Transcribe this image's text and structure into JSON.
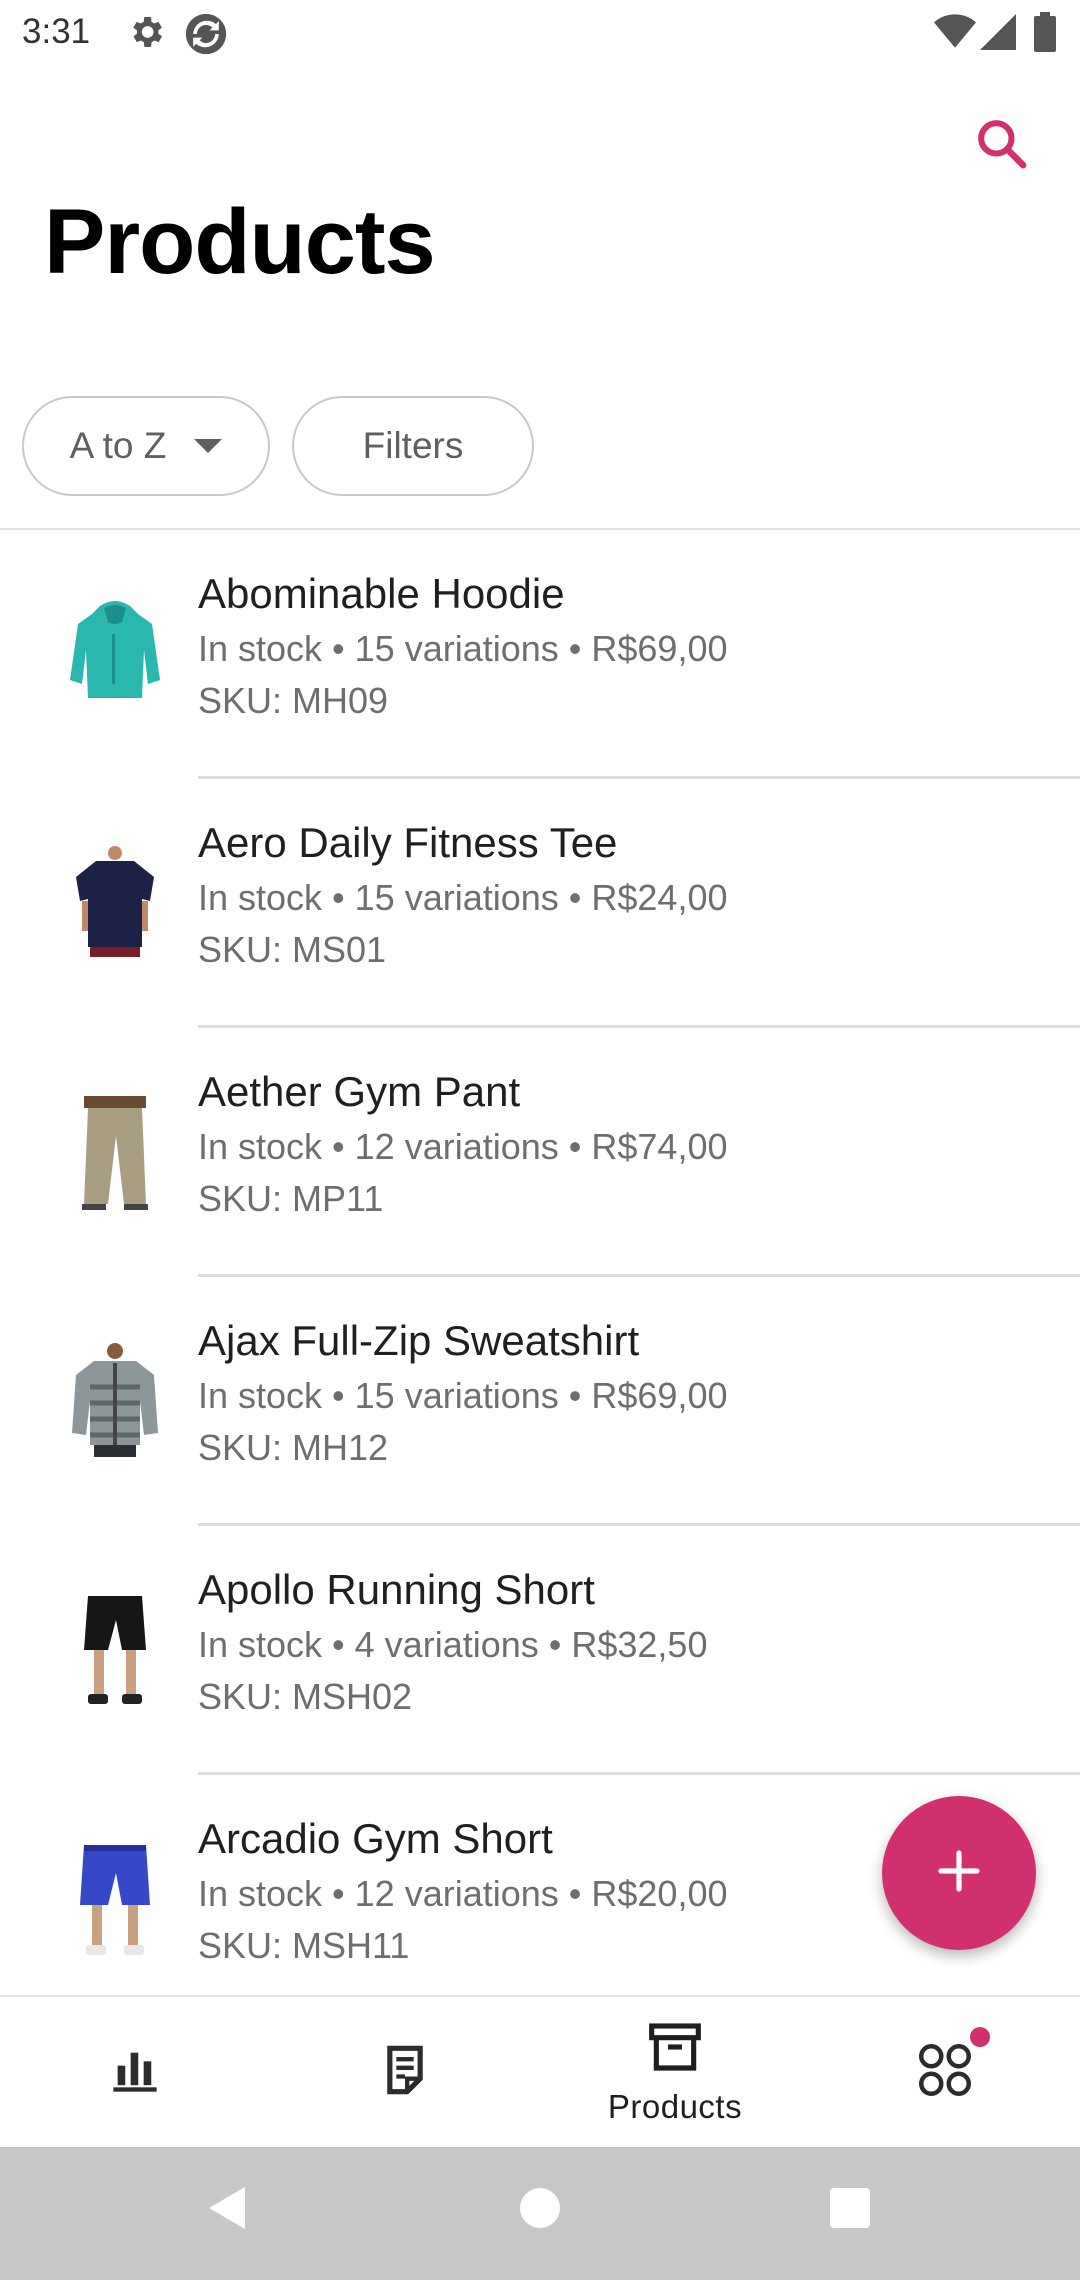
{
  "status_bar": {
    "time": "3:31",
    "icons": [
      "gear-icon",
      "sync-icon",
      "wifi-icon",
      "signal-icon",
      "battery-icon"
    ]
  },
  "header": {
    "title": "Products",
    "search_icon": "search-icon"
  },
  "filters": {
    "sort_label": "A to Z",
    "filters_label": "Filters"
  },
  "colors": {
    "accent": "#d0306e",
    "text_primary": "#1f1f1f",
    "text_secondary": "#6e6e6e",
    "system_nav": "#c8c8c8"
  },
  "products": [
    {
      "name": "Abominable Hoodie",
      "meta": "In stock • 15 variations • R$69,00",
      "sku": "SKU: MH09"
    },
    {
      "name": "Aero Daily Fitness Tee",
      "meta": "In stock • 15 variations • R$24,00",
      "sku": "SKU: MS01"
    },
    {
      "name": "Aether Gym Pant",
      "meta": "In stock • 12 variations • R$74,00",
      "sku": "SKU: MP11"
    },
    {
      "name": "Ajax Full-Zip Sweatshirt",
      "meta": "In stock • 15 variations • R$69,00",
      "sku": "SKU: MH12"
    },
    {
      "name": "Apollo Running Short",
      "meta": "In stock • 4 variations • R$32,50",
      "sku": "SKU: MSH02"
    },
    {
      "name": "Arcadio Gym Short",
      "meta": "In stock • 12 variations • R$20,00",
      "sku": "SKU: MSH11"
    }
  ],
  "fab": {
    "icon": "plus-icon"
  },
  "bottom_nav": {
    "items": [
      {
        "icon": "bar-chart-icon",
        "label": ""
      },
      {
        "icon": "orders-icon",
        "label": ""
      },
      {
        "icon": "archive-box-icon",
        "label": "Products"
      },
      {
        "icon": "more-grid-icon",
        "label": ""
      }
    ]
  },
  "system_nav": {
    "icons": [
      "back-icon",
      "home-icon",
      "recents-icon"
    ]
  }
}
